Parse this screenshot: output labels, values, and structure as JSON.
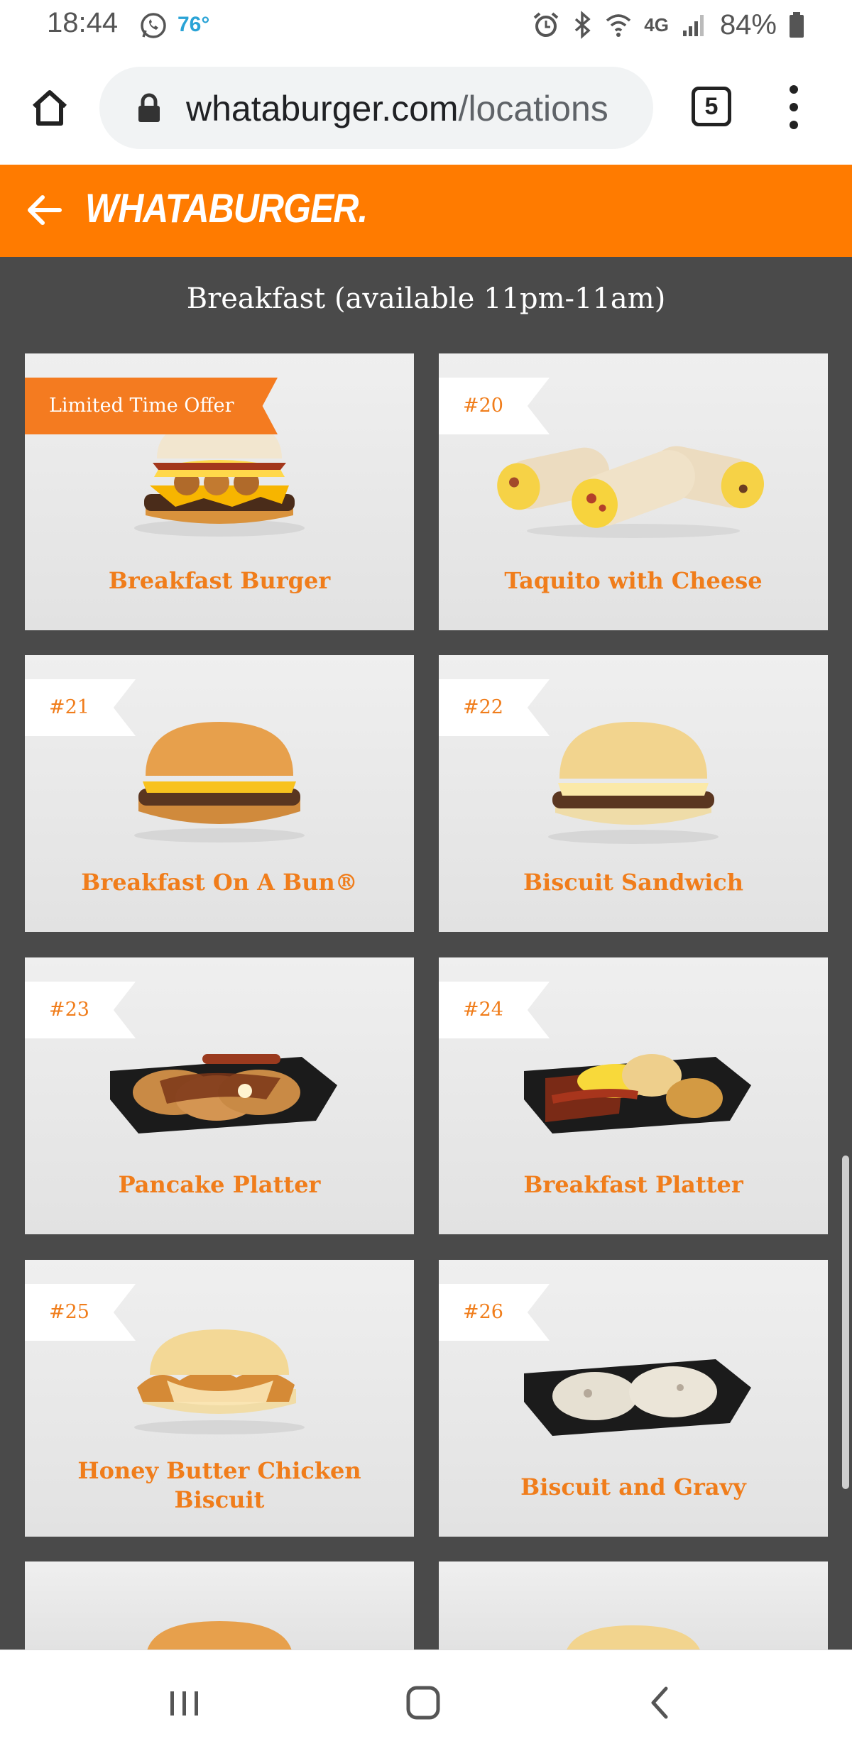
{
  "status_bar": {
    "time": "18:44",
    "temperature": "76°",
    "network": "4G",
    "battery": "84%"
  },
  "browser": {
    "url_domain": "whataburger.com",
    "url_path": "/locations",
    "tab_count": "5"
  },
  "header": {
    "brand": "WHATABURGER."
  },
  "section": {
    "title": "Breakfast (available 11pm-11am)"
  },
  "menu": {
    "items": [
      {
        "badge": "Limited Time Offer",
        "name_line1": "Breakfast Burger",
        "name_line2": ""
      },
      {
        "badge": "#20",
        "name_line1": "Taquito with Cheese",
        "name_line2": ""
      },
      {
        "badge": "#21",
        "name_line1": "Breakfast On A Bun®",
        "name_line2": ""
      },
      {
        "badge": "#22",
        "name_line1": "Biscuit Sandwich",
        "name_line2": ""
      },
      {
        "badge": "#23",
        "name_line1": "Pancake Platter",
        "name_line2": ""
      },
      {
        "badge": "#24",
        "name_line1": "Breakfast Platter",
        "name_line2": ""
      },
      {
        "badge": "#25",
        "name_line1": "Honey Butter Chicken",
        "name_line2": "Biscuit"
      },
      {
        "badge": "#26",
        "name_line1": "Biscuit and Gravy",
        "name_line2": ""
      }
    ]
  },
  "colors": {
    "brand_orange": "#ff7b00",
    "item_text": "#f07d1b",
    "page_bg": "#4a4a4a"
  },
  "icons": {
    "home": "home-icon",
    "lock": "lock-icon",
    "menu": "more-vert-icon",
    "back": "arrow-left-icon",
    "nav_recents": "recents-icon",
    "nav_home": "home-square-icon",
    "nav_back": "chevron-left-icon"
  }
}
